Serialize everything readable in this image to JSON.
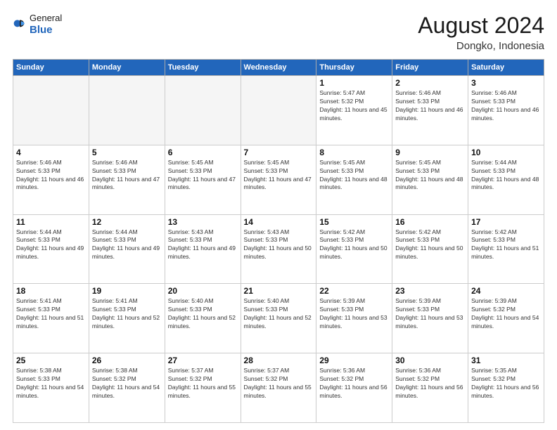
{
  "header": {
    "logo_general": "General",
    "logo_blue": "Blue",
    "month_year": "August 2024",
    "location": "Dongko, Indonesia"
  },
  "days_of_week": [
    "Sunday",
    "Monday",
    "Tuesday",
    "Wednesday",
    "Thursday",
    "Friday",
    "Saturday"
  ],
  "weeks": [
    [
      {
        "day": "",
        "empty": true
      },
      {
        "day": "",
        "empty": true
      },
      {
        "day": "",
        "empty": true
      },
      {
        "day": "",
        "empty": true
      },
      {
        "day": "1",
        "sunrise": "5:47 AM",
        "sunset": "5:32 PM",
        "daylight": "11 hours and 45 minutes."
      },
      {
        "day": "2",
        "sunrise": "5:46 AM",
        "sunset": "5:33 PM",
        "daylight": "11 hours and 46 minutes."
      },
      {
        "day": "3",
        "sunrise": "5:46 AM",
        "sunset": "5:33 PM",
        "daylight": "11 hours and 46 minutes."
      }
    ],
    [
      {
        "day": "4",
        "sunrise": "5:46 AM",
        "sunset": "5:33 PM",
        "daylight": "11 hours and 46 minutes."
      },
      {
        "day": "5",
        "sunrise": "5:46 AM",
        "sunset": "5:33 PM",
        "daylight": "11 hours and 47 minutes."
      },
      {
        "day": "6",
        "sunrise": "5:45 AM",
        "sunset": "5:33 PM",
        "daylight": "11 hours and 47 minutes."
      },
      {
        "day": "7",
        "sunrise": "5:45 AM",
        "sunset": "5:33 PM",
        "daylight": "11 hours and 47 minutes."
      },
      {
        "day": "8",
        "sunrise": "5:45 AM",
        "sunset": "5:33 PM",
        "daylight": "11 hours and 48 minutes."
      },
      {
        "day": "9",
        "sunrise": "5:45 AM",
        "sunset": "5:33 PM",
        "daylight": "11 hours and 48 minutes."
      },
      {
        "day": "10",
        "sunrise": "5:44 AM",
        "sunset": "5:33 PM",
        "daylight": "11 hours and 48 minutes."
      }
    ],
    [
      {
        "day": "11",
        "sunrise": "5:44 AM",
        "sunset": "5:33 PM",
        "daylight": "11 hours and 49 minutes."
      },
      {
        "day": "12",
        "sunrise": "5:44 AM",
        "sunset": "5:33 PM",
        "daylight": "11 hours and 49 minutes."
      },
      {
        "day": "13",
        "sunrise": "5:43 AM",
        "sunset": "5:33 PM",
        "daylight": "11 hours and 49 minutes."
      },
      {
        "day": "14",
        "sunrise": "5:43 AM",
        "sunset": "5:33 PM",
        "daylight": "11 hours and 50 minutes."
      },
      {
        "day": "15",
        "sunrise": "5:42 AM",
        "sunset": "5:33 PM",
        "daylight": "11 hours and 50 minutes."
      },
      {
        "day": "16",
        "sunrise": "5:42 AM",
        "sunset": "5:33 PM",
        "daylight": "11 hours and 50 minutes."
      },
      {
        "day": "17",
        "sunrise": "5:42 AM",
        "sunset": "5:33 PM",
        "daylight": "11 hours and 51 minutes."
      }
    ],
    [
      {
        "day": "18",
        "sunrise": "5:41 AM",
        "sunset": "5:33 PM",
        "daylight": "11 hours and 51 minutes."
      },
      {
        "day": "19",
        "sunrise": "5:41 AM",
        "sunset": "5:33 PM",
        "daylight": "11 hours and 52 minutes."
      },
      {
        "day": "20",
        "sunrise": "5:40 AM",
        "sunset": "5:33 PM",
        "daylight": "11 hours and 52 minutes."
      },
      {
        "day": "21",
        "sunrise": "5:40 AM",
        "sunset": "5:33 PM",
        "daylight": "11 hours and 52 minutes."
      },
      {
        "day": "22",
        "sunrise": "5:39 AM",
        "sunset": "5:33 PM",
        "daylight": "11 hours and 53 minutes."
      },
      {
        "day": "23",
        "sunrise": "5:39 AM",
        "sunset": "5:33 PM",
        "daylight": "11 hours and 53 minutes."
      },
      {
        "day": "24",
        "sunrise": "5:39 AM",
        "sunset": "5:32 PM",
        "daylight": "11 hours and 54 minutes."
      }
    ],
    [
      {
        "day": "25",
        "sunrise": "5:38 AM",
        "sunset": "5:33 PM",
        "daylight": "11 hours and 54 minutes."
      },
      {
        "day": "26",
        "sunrise": "5:38 AM",
        "sunset": "5:32 PM",
        "daylight": "11 hours and 54 minutes."
      },
      {
        "day": "27",
        "sunrise": "5:37 AM",
        "sunset": "5:32 PM",
        "daylight": "11 hours and 55 minutes."
      },
      {
        "day": "28",
        "sunrise": "5:37 AM",
        "sunset": "5:32 PM",
        "daylight": "11 hours and 55 minutes."
      },
      {
        "day": "29",
        "sunrise": "5:36 AM",
        "sunset": "5:32 PM",
        "daylight": "11 hours and 56 minutes."
      },
      {
        "day": "30",
        "sunrise": "5:36 AM",
        "sunset": "5:32 PM",
        "daylight": "11 hours and 56 minutes."
      },
      {
        "day": "31",
        "sunrise": "5:35 AM",
        "sunset": "5:32 PM",
        "daylight": "11 hours and 56 minutes."
      }
    ]
  ],
  "labels": {
    "sunrise_prefix": "Sunrise: ",
    "sunset_prefix": "Sunset: ",
    "daylight_prefix": "Daylight: "
  }
}
